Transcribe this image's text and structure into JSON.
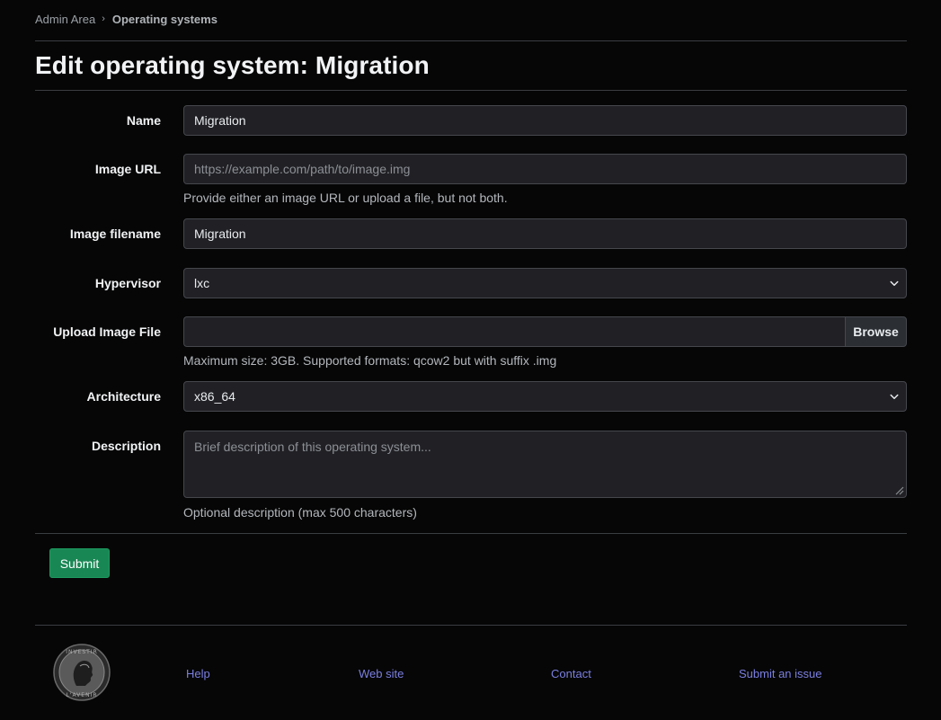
{
  "breadcrumb": {
    "items": [
      {
        "label": "Admin Area"
      },
      {
        "label": "Operating systems"
      }
    ]
  },
  "page": {
    "title": "Edit operating system: Migration"
  },
  "form": {
    "name": {
      "label": "Name",
      "value": "Migration"
    },
    "image_url": {
      "label": "Image URL",
      "placeholder": "https://example.com/path/to/image.img",
      "help": "Provide either an image URL or upload a file, but not both."
    },
    "image_filename": {
      "label": "Image filename",
      "value": "Migration"
    },
    "hypervisor": {
      "label": "Hypervisor",
      "selected": "lxc"
    },
    "upload": {
      "label": "Upload Image File",
      "browse_label": "Browse",
      "help": "Maximum size: 3GB. Supported formats: qcow2 but with suffix .img"
    },
    "architecture": {
      "label": "Architecture",
      "selected": "x86_64"
    },
    "description": {
      "label": "Description",
      "placeholder": "Brief description of this operating system...",
      "help": "Optional description (max 500 characters)"
    },
    "submit_label": "Submit"
  },
  "footer": {
    "logo_text": "INVESTIR L'AVENIR",
    "links": [
      {
        "label": "Help"
      },
      {
        "label": "Web site"
      },
      {
        "label": "Contact"
      },
      {
        "label": "Submit an issue"
      }
    ]
  },
  "colors": {
    "background": "#060606",
    "input_bg": "#212125",
    "submit": "#198754",
    "link": "#7b7fe0"
  }
}
